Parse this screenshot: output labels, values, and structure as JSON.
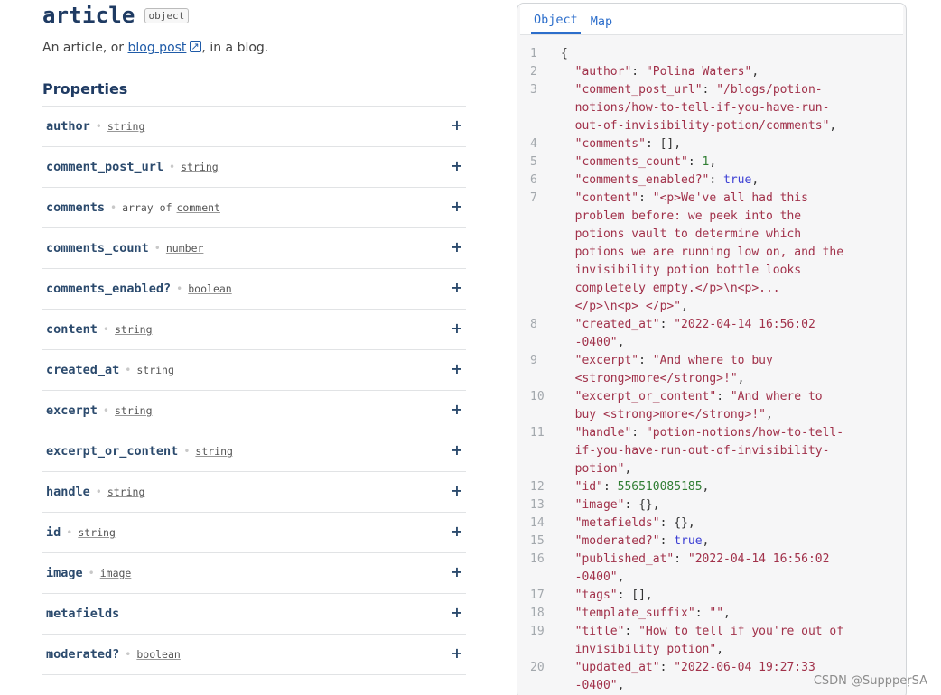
{
  "header": {
    "title": "article",
    "type_chip": "object",
    "desc_prefix": "An article, or ",
    "desc_link": "blog post",
    "desc_suffix": ", in a blog."
  },
  "properties_heading": "Properties",
  "properties": [
    {
      "name": "author",
      "type": "string"
    },
    {
      "name": "comment_post_url",
      "type": "string"
    },
    {
      "name": "comments",
      "type_prefix": "array of",
      "type": "comment"
    },
    {
      "name": "comments_count",
      "type": "number"
    },
    {
      "name": "comments_enabled?",
      "type": "boolean"
    },
    {
      "name": "content",
      "type": "string"
    },
    {
      "name": "created_at",
      "type": "string"
    },
    {
      "name": "excerpt",
      "type": "string"
    },
    {
      "name": "excerpt_or_content",
      "type": "string"
    },
    {
      "name": "handle",
      "type": "string"
    },
    {
      "name": "id",
      "type": "string"
    },
    {
      "name": "image",
      "type": "image"
    },
    {
      "name": "metafields",
      "type": ""
    },
    {
      "name": "moderated?",
      "type": "boolean"
    }
  ],
  "expand_label": "+",
  "panel": {
    "tabs": [
      "Object",
      "Map"
    ],
    "active_tab": "Object"
  },
  "code_lines": [
    {
      "n": "1",
      "parts": [
        [
          "p",
          "{"
        ]
      ]
    },
    {
      "n": "2",
      "parts": [
        [
          "p",
          "  "
        ],
        [
          "k",
          "\"author\""
        ],
        [
          "p",
          ": "
        ],
        [
          "s",
          "\"Polina Waters\""
        ],
        [
          "p",
          ","
        ]
      ]
    },
    {
      "n": "3",
      "parts": [
        [
          "p",
          "  "
        ],
        [
          "k",
          "\"comment_post_url\""
        ],
        [
          "p",
          ": "
        ],
        [
          "s",
          "\"/blogs/potion-"
        ]
      ]
    },
    {
      "n": "",
      "parts": [
        [
          "s",
          "  notions/how-to-tell-if-you-have-run-"
        ]
      ]
    },
    {
      "n": "",
      "parts": [
        [
          "s",
          "  out-of-invisibility-potion/comments\""
        ],
        [
          "p",
          ","
        ]
      ]
    },
    {
      "n": "4",
      "parts": [
        [
          "p",
          "  "
        ],
        [
          "k",
          "\"comments\""
        ],
        [
          "p",
          ": [],"
        ]
      ]
    },
    {
      "n": "5",
      "parts": [
        [
          "p",
          "  "
        ],
        [
          "k",
          "\"comments_count\""
        ],
        [
          "p",
          ": "
        ],
        [
          "n",
          "1"
        ],
        [
          "p",
          ","
        ]
      ]
    },
    {
      "n": "6",
      "parts": [
        [
          "p",
          "  "
        ],
        [
          "k",
          "\"comments_enabled?\""
        ],
        [
          "p",
          ": "
        ],
        [
          "b",
          "true"
        ],
        [
          "p",
          ","
        ]
      ]
    },
    {
      "n": "7",
      "parts": [
        [
          "p",
          "  "
        ],
        [
          "k",
          "\"content\""
        ],
        [
          "p",
          ": "
        ],
        [
          "s",
          "\"<p>We've all had this"
        ]
      ]
    },
    {
      "n": "",
      "parts": [
        [
          "s",
          "  problem before: we peek into the"
        ]
      ]
    },
    {
      "n": "",
      "parts": [
        [
          "s",
          "  potions vault to determine which"
        ]
      ]
    },
    {
      "n": "",
      "parts": [
        [
          "s",
          "  potions we are running low on, and the"
        ]
      ]
    },
    {
      "n": "",
      "parts": [
        [
          "s",
          "  invisibility potion bottle looks"
        ]
      ]
    },
    {
      "n": "",
      "parts": [
        [
          "s",
          "  completely empty.</p>\\n<p>..."
        ]
      ]
    },
    {
      "n": "",
      "parts": [
        [
          "s",
          "  </p>\\n<p> </p>\""
        ],
        [
          "p",
          ","
        ]
      ]
    },
    {
      "n": "8",
      "parts": [
        [
          "p",
          "  "
        ],
        [
          "k",
          "\"created_at\""
        ],
        [
          "p",
          ": "
        ],
        [
          "s",
          "\"2022-04-14 16:56:02"
        ]
      ]
    },
    {
      "n": "",
      "parts": [
        [
          "s",
          "  -0400\""
        ],
        [
          "p",
          ","
        ]
      ]
    },
    {
      "n": "9",
      "parts": [
        [
          "p",
          "  "
        ],
        [
          "k",
          "\"excerpt\""
        ],
        [
          "p",
          ": "
        ],
        [
          "s",
          "\"And where to buy"
        ]
      ]
    },
    {
      "n": "",
      "parts": [
        [
          "s",
          "  <strong>more</strong>!\""
        ],
        [
          "p",
          ","
        ]
      ]
    },
    {
      "n": "10",
      "parts": [
        [
          "p",
          "  "
        ],
        [
          "k",
          "\"excerpt_or_content\""
        ],
        [
          "p",
          ": "
        ],
        [
          "s",
          "\"And where to"
        ]
      ]
    },
    {
      "n": "",
      "parts": [
        [
          "s",
          "  buy <strong>more</strong>!\""
        ],
        [
          "p",
          ","
        ]
      ]
    },
    {
      "n": "11",
      "parts": [
        [
          "p",
          "  "
        ],
        [
          "k",
          "\"handle\""
        ],
        [
          "p",
          ": "
        ],
        [
          "s",
          "\"potion-notions/how-to-tell-"
        ]
      ]
    },
    {
      "n": "",
      "parts": [
        [
          "s",
          "  if-you-have-run-out-of-invisibility-"
        ]
      ]
    },
    {
      "n": "",
      "parts": [
        [
          "s",
          "  potion\""
        ],
        [
          "p",
          ","
        ]
      ]
    },
    {
      "n": "12",
      "parts": [
        [
          "p",
          "  "
        ],
        [
          "k",
          "\"id\""
        ],
        [
          "p",
          ": "
        ],
        [
          "n",
          "556510085185"
        ],
        [
          "p",
          ","
        ]
      ]
    },
    {
      "n": "13",
      "parts": [
        [
          "p",
          "  "
        ],
        [
          "k",
          "\"image\""
        ],
        [
          "p",
          ": {},"
        ]
      ]
    },
    {
      "n": "14",
      "parts": [
        [
          "p",
          "  "
        ],
        [
          "k",
          "\"metafields\""
        ],
        [
          "p",
          ": {},"
        ]
      ]
    },
    {
      "n": "15",
      "parts": [
        [
          "p",
          "  "
        ],
        [
          "k",
          "\"moderated?\""
        ],
        [
          "p",
          ": "
        ],
        [
          "b",
          "true"
        ],
        [
          "p",
          ","
        ]
      ]
    },
    {
      "n": "16",
      "parts": [
        [
          "p",
          "  "
        ],
        [
          "k",
          "\"published_at\""
        ],
        [
          "p",
          ": "
        ],
        [
          "s",
          "\"2022-04-14 16:56:02"
        ]
      ]
    },
    {
      "n": "",
      "parts": [
        [
          "s",
          "  -0400\""
        ],
        [
          "p",
          ","
        ]
      ]
    },
    {
      "n": "17",
      "parts": [
        [
          "p",
          "  "
        ],
        [
          "k",
          "\"tags\""
        ],
        [
          "p",
          ": [],"
        ]
      ]
    },
    {
      "n": "18",
      "parts": [
        [
          "p",
          "  "
        ],
        [
          "k",
          "\"template_suffix\""
        ],
        [
          "p",
          ": "
        ],
        [
          "s",
          "\"\""
        ],
        [
          "p",
          ","
        ]
      ]
    },
    {
      "n": "19",
      "parts": [
        [
          "p",
          "  "
        ],
        [
          "k",
          "\"title\""
        ],
        [
          "p",
          ": "
        ],
        [
          "s",
          "\"How to tell if you're out of"
        ]
      ]
    },
    {
      "n": "",
      "parts": [
        [
          "s",
          "  invisibility potion\""
        ],
        [
          "p",
          ","
        ]
      ]
    },
    {
      "n": "20",
      "parts": [
        [
          "p",
          "  "
        ],
        [
          "k",
          "\"updated_at\""
        ],
        [
          "p",
          ": "
        ],
        [
          "s",
          "\"2022-06-04 19:27:33"
        ]
      ]
    },
    {
      "n": "",
      "parts": [
        [
          "s",
          "  -0400\""
        ],
        [
          "p",
          ","
        ]
      ]
    }
  ],
  "watermark": "CSDN @SupppeṛSA"
}
